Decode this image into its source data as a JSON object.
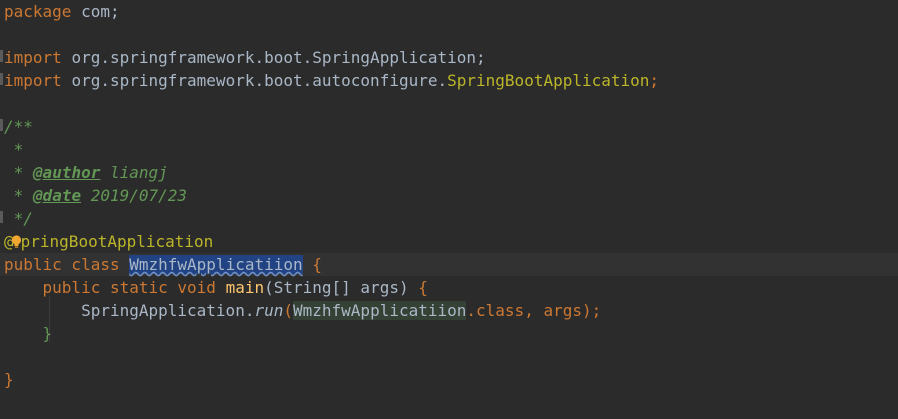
{
  "code": {
    "package_kw": "package",
    "package_name": "com;",
    "import_kw": "import",
    "import1_name": "org.springframework.boot.SpringApplication;",
    "import2_prefix": "org.springframework.boot.autoconfigure.",
    "import2_class": "SpringBootApplication",
    "import2_semicolon": ";",
    "doc_open": "/**",
    "doc_star": "*",
    "doc_author_tag": "@author",
    "doc_author_value": "liangj",
    "doc_date_tag": "@date",
    "doc_date_value": "2019/07/23",
    "doc_close": "*/",
    "annotation_prefix": "@",
    "annotation_rest": "pringBootApplication",
    "class_modifiers": "public class",
    "class_name": "WmzhfwApplicatiion",
    "open_brace": "{",
    "method_modifiers": "public static void",
    "method_name": "main",
    "method_params": "(String[] args)",
    "call_target": "SpringApplication.",
    "call_method": "run",
    "call_open_paren": "(",
    "call_arg_class": "WmzhfwApplicatiion",
    "call_dot_class": ".class",
    "call_rest": ", args",
    "call_close": ");",
    "method_close_brace": "}",
    "class_close_brace": "}"
  },
  "icons": {
    "intention_bulb": "lightbulb-icon"
  },
  "colors": {
    "background": "#2b2b2b",
    "keyword": "#cc7832",
    "annotation": "#bbb529",
    "javadoc": "#629755",
    "method_decl": "#ffc66d",
    "text": "#a9b7c6",
    "selection": "#214283",
    "bulb": "#f0a732"
  }
}
